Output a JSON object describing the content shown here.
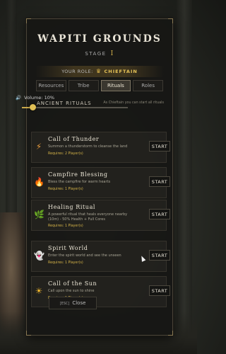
{
  "panel": {
    "title": "WAPITI GROUNDS",
    "stage_label": "STAGE",
    "stage_value": "I"
  },
  "role": {
    "label": "YOUR ROLE:",
    "icon": "crown-icon",
    "value": "CHIEFTAIN"
  },
  "tabs": [
    {
      "label": "Resources",
      "active": false
    },
    {
      "label": "Tribe",
      "active": false
    },
    {
      "label": "Rituals",
      "active": true
    },
    {
      "label": "Roles",
      "active": false
    }
  ],
  "section": {
    "title": "ANCIENT RITUALS",
    "note": "As Chieftain you can start all rituals"
  },
  "volume": {
    "label": "Volume:",
    "value_text": "10%",
    "fraction": 0.1
  },
  "rituals": [
    {
      "name": "Call of Thunder",
      "desc": "Summon a thunderstorm to cleanse the land",
      "requires": "Requires: 2 Player(s)",
      "icon": "lightning-icon",
      "icon_glyph": "⚡",
      "icon_color": "#e39a3c",
      "button": "START"
    },
    {
      "name": "Campfire Blessing",
      "desc": "Bless the campfire for warm hearts",
      "requires": "Requires: 1 Player(s)",
      "icon": "flame-icon",
      "icon_glyph": "🔥",
      "icon_color": "#e8672a",
      "button": "START"
    },
    {
      "name": "Healing Ritual",
      "desc": "A powerful ritual that heals everyone nearby (10m) - 50% Health + Full Cores",
      "requires": "Requires: 1 Player(s)",
      "icon": "herb-icon",
      "icon_glyph": "🌿",
      "icon_color": "#7fb04a",
      "button": "START"
    },
    {
      "name": "Spirit World",
      "desc": "Enter the spirit world and see the unseen",
      "requires": "Requires: 1 Player(s)",
      "icon": "ghost-icon",
      "icon_glyph": "👻",
      "icon_color": "#e6e6f0",
      "button": "START"
    },
    {
      "name": "Call of the Sun",
      "desc": "Call upon the sun to shine",
      "requires": "Requires: 1 Player(s)",
      "icon": "sun-icon",
      "icon_glyph": "☀",
      "icon_color": "#f2b82e",
      "button": "START"
    }
  ],
  "close": {
    "key": "[ESC]",
    "label": "Close"
  }
}
